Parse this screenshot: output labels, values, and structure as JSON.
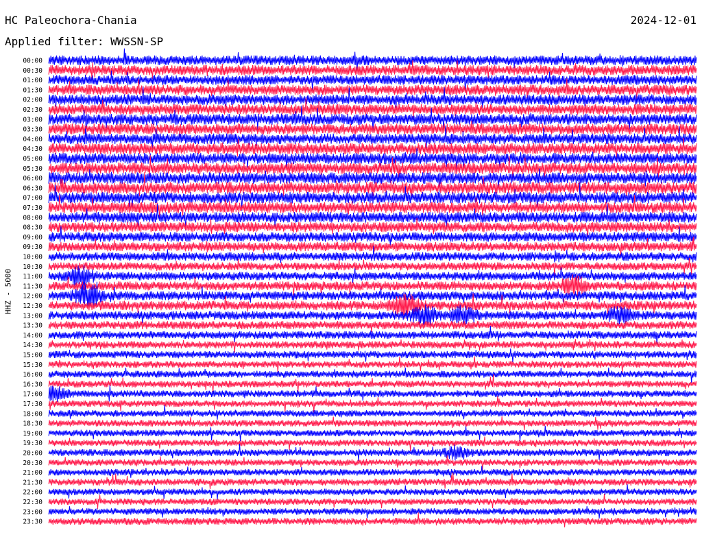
{
  "header": {
    "station": "HC Paleochora-Chania",
    "date": "2024-12-01",
    "filter_text": "Applied filter: WWSSN-SP"
  },
  "chart_data": {
    "type": "line",
    "title": "HC Paleochora-Chania",
    "subtitle": "Applied filter: WWSSN-SP",
    "ylabel": "HHZ - 5000",
    "xlabel": "",
    "grid": false,
    "legend": "none",
    "row_labels": [
      "00:00",
      "00:30",
      "01:00",
      "01:30",
      "02:00",
      "02:30",
      "03:00",
      "03:30",
      "04:00",
      "04:30",
      "05:00",
      "05:30",
      "06:00",
      "06:30",
      "07:00",
      "07:30",
      "08:00",
      "08:30",
      "09:00",
      "09:30",
      "10:00",
      "10:30",
      "11:00",
      "11:30",
      "12:00",
      "12:30",
      "13:00",
      "13:30",
      "14:00",
      "14:30",
      "15:00",
      "15:30",
      "16:00",
      "16:30",
      "17:00",
      "17:30",
      "18:00",
      "18:30",
      "19:00",
      "19:30",
      "20:00",
      "20:30",
      "21:00",
      "21:30",
      "22:00",
      "22:30",
      "23:00",
      "23:30"
    ],
    "series_colors": [
      "#0000ff",
      "#ff1a4b"
    ],
    "relative_amplitude": [
      1.2,
      1.25,
      1.2,
      1.25,
      1.3,
      1.3,
      1.35,
      1.35,
      1.3,
      1.4,
      1.35,
      1.4,
      1.4,
      1.45,
      1.4,
      1.35,
      1.3,
      1.25,
      1.2,
      1.15,
      1.05,
      1.0,
      1.05,
      1.1,
      1.1,
      1.15,
      1.05,
      1.0,
      0.95,
      0.9,
      0.9,
      0.85,
      0.85,
      0.85,
      0.85,
      0.8,
      0.8,
      0.8,
      0.8,
      0.8,
      0.85,
      0.8,
      0.8,
      0.85,
      0.8,
      0.8,
      0.8,
      0.85
    ],
    "events": [
      {
        "row": 22,
        "x": 0.05,
        "strength": 1.8
      },
      {
        "row": 24,
        "x": 0.06,
        "strength": 2.2
      },
      {
        "row": 25,
        "x": 0.55,
        "strength": 2.0
      },
      {
        "row": 26,
        "x": 0.58,
        "strength": 2.0
      },
      {
        "row": 26,
        "x": 0.64,
        "strength": 1.6
      },
      {
        "row": 23,
        "x": 0.81,
        "strength": 1.7
      },
      {
        "row": 26,
        "x": 0.88,
        "strength": 1.5
      },
      {
        "row": 34,
        "x": 0.01,
        "strength": 1.5
      },
      {
        "row": 40,
        "x": 0.63,
        "strength": 1.4
      }
    ]
  }
}
